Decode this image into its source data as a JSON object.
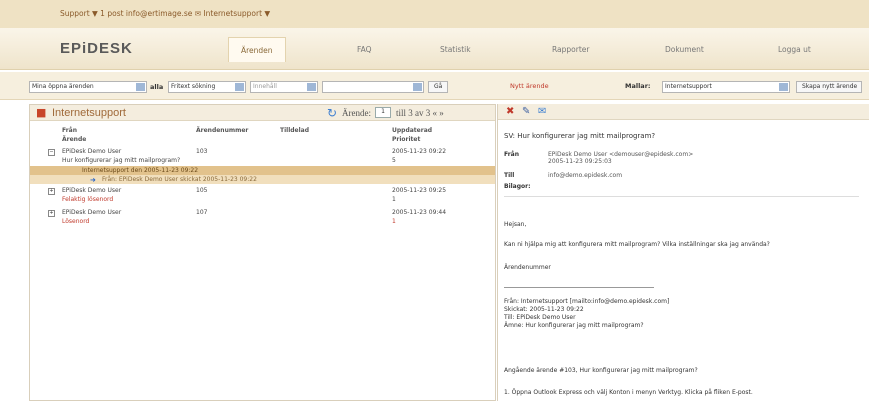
{
  "top_links": "Support ▼ 1 post  info@ertimage.se ✉  Internetsupport ▼",
  "logo": "EPiDESK",
  "nav": [
    "Ärenden",
    "FAQ",
    "Statistik",
    "Rapporter",
    "Dokument",
    "Logga ut"
  ],
  "toolbar": {
    "filter_select": "Mina öppna ärenden",
    "filter_label": "alla",
    "sort_select": "Fritext sökning",
    "sort_select2": "Innehåll",
    "search_value": "",
    "go_label": "Gå",
    "new_case": "Nytt ärende",
    "template_label": "Mallar:",
    "template_select": "Internetsupport",
    "add_button": "Skapa nytt ärende"
  },
  "list": {
    "title": "Internetsupport",
    "pager_prefix": "Ärende:",
    "page_value": "1",
    "pager_suffix": "till 3 av 3 « »",
    "columns": [
      {
        "top": "Från",
        "bottom": "Ärende"
      },
      {
        "top": "Ärendenummer",
        "bottom": ""
      },
      {
        "top": "Tilldelad",
        "bottom": ""
      },
      {
        "top": "Uppdaterad",
        "bottom": "Prioritet"
      }
    ],
    "rows": [
      {
        "from": "EPiDesk Demo User",
        "subject": "Hur konfigurerar jag mitt mailprogram?",
        "num": "103",
        "updated": "2005-11-23 09:22",
        "status": "5"
      },
      {
        "from": "EPiDesk Demo User",
        "subject": "Felaktig lösenord",
        "num": "105",
        "updated": "2005-11-23 09:25",
        "status": "1"
      },
      {
        "from": "EPiDesk Demo User",
        "subject": "Lösenord",
        "num": "107",
        "updated": "2005-11-23 09:44",
        "status": "1"
      }
    ],
    "sel_row1": "Internetsupport den 2005-11-23 09:22",
    "sel_row2": "Från: EPiDesk Demo User skickat 2005-11-23 09:22"
  },
  "detail": {
    "subject": "SV: Hur konfigurerar jag mitt mailprogram?",
    "from_label": "Från",
    "from_value": "EPiDesk Demo User <demouser@epidesk.com>",
    "from_date": "2005-11-23 09:25:03",
    "to_label": "Till",
    "to_value": "info@demo.epidesk.com",
    "att_label": "Bilagor:",
    "lines": [
      "Hejsan,",
      "Kan ni hjälpa mig att konfigurera mitt mailprogram? Vilka inställningar ska jag använda?",
      "Ärendenummer",
      "----------------------------------------",
      "Från: Internetsupport [mailto:info@demo.epidesk.com]",
      "Skickat: 2005-11-23 09:22",
      "Till: EPiDesk Demo User",
      "Ämne: Hur konfigurerar jag mitt mailprogram?",
      "Angående ärende #103, Hur konfigurerar jag mitt mailprogram?",
      "1. Öppna Outlook Express och välj Konton i menyn Verktyg. Klicka på fliken E-post."
    ]
  }
}
